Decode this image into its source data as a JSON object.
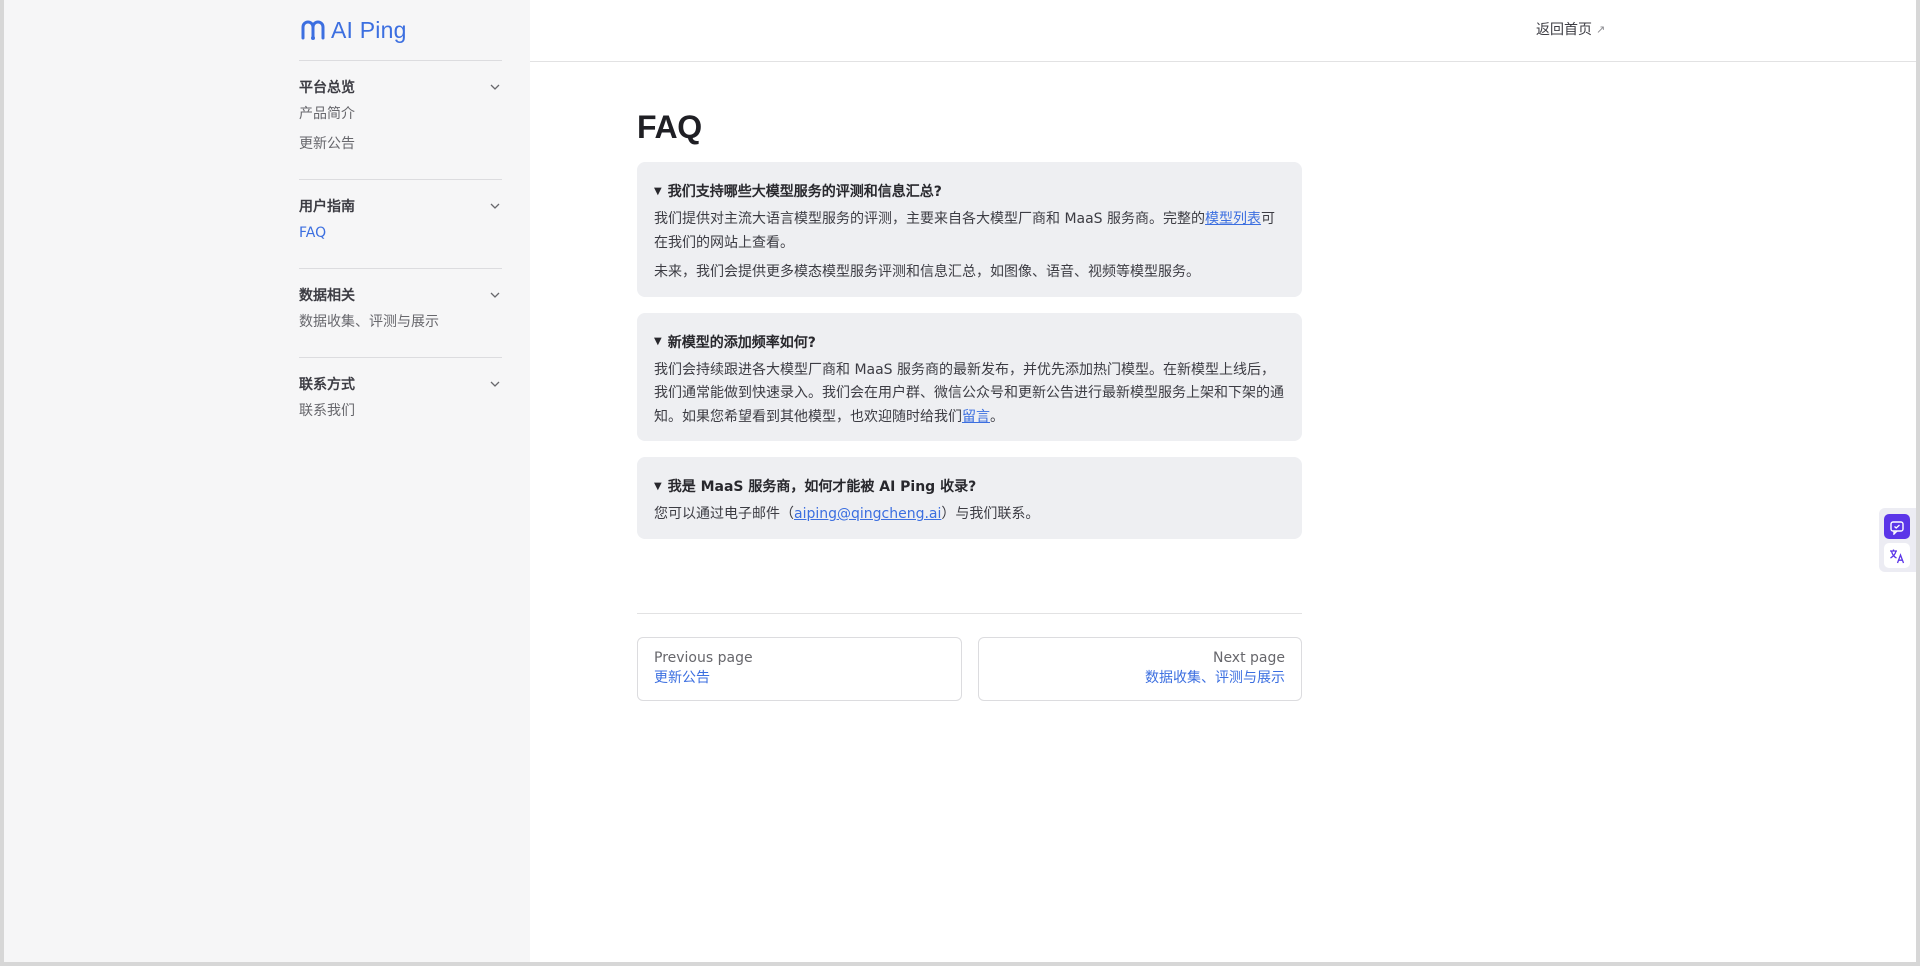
{
  "logo": {
    "text": "AI Ping"
  },
  "sidebar": {
    "groups": [
      {
        "title": "平台总览",
        "items": [
          {
            "label": "产品简介"
          },
          {
            "label": "更新公告"
          }
        ]
      },
      {
        "title": "用户指南",
        "items": [
          {
            "label": "FAQ",
            "active": true
          }
        ]
      },
      {
        "title": "数据相关",
        "items": [
          {
            "label": "数据收集、评测与展示"
          }
        ]
      },
      {
        "title": "联系方式",
        "items": [
          {
            "label": "联系我们"
          }
        ]
      }
    ]
  },
  "topbar": {
    "back_home": "返回首页",
    "back_home_arrow": "↗"
  },
  "page": {
    "title": "FAQ"
  },
  "faqs": [
    {
      "question": "我们支持哪些大模型服务的评测和信息汇总?",
      "p1_before": "我们提供对主流大语言模型服务的评测，主要来自各大模型厂商和 MaaS 服务商。完整的",
      "p1_link": "模型列表",
      "p1_after": "可在我们的网站上查看。",
      "p2": "未来，我们会提供更多模态模型服务评测和信息汇总，如图像、语音、视频等模型服务。"
    },
    {
      "question": "新模型的添加频率如何?",
      "p1_before": "我们会持续跟进各大模型厂商和 MaaS 服务商的最新发布，并优先添加热门模型。在新模型上线后，我们通常能做到快速录入。我们会在用户群、微信公众号和更新公告进行最新模型服务上架和下架的通知。如果您希望看到其他模型，也欢迎随时给我们",
      "p1_link": "留言",
      "p1_after": "。"
    },
    {
      "question": "我是 MaaS 服务商，如何才能被 AI Ping 收录?",
      "p1_before": "您可以通过电子邮件（",
      "p1_link": "aiping@qingcheng.ai",
      "p1_after": "）与我们联系。"
    }
  ],
  "pager": {
    "prev": {
      "desc": "Previous page",
      "title": "更新公告"
    },
    "next": {
      "desc": "Next page",
      "title": "数据收集、评测与展示"
    }
  },
  "colors": {
    "accent": "#3c6fe0",
    "tool_primary": "#5b35e8",
    "sidebar_bg": "#f6f6f7",
    "faq_bg": "#eeeff2"
  }
}
